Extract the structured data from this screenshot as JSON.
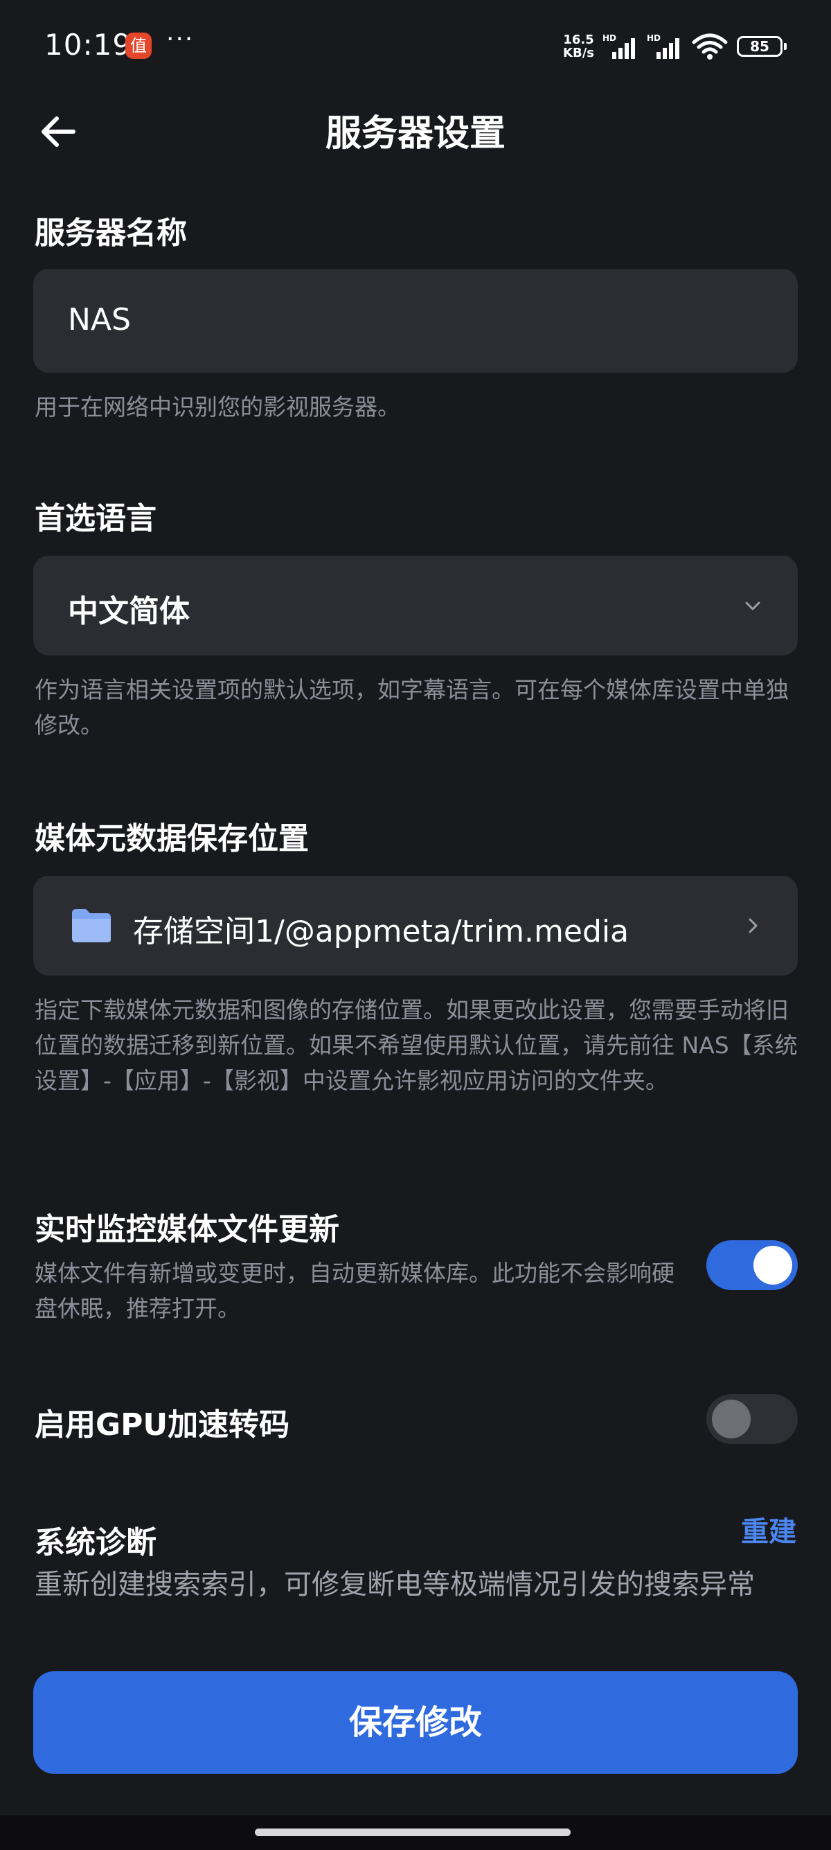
{
  "status_bar": {
    "time": "10:19",
    "app_badge": "值",
    "more": "···",
    "net_speed_value": "16.5",
    "net_speed_unit": "KB/s",
    "hd_1": "HD",
    "hd_2": "HD",
    "battery": "85"
  },
  "header": {
    "title": "服务器设置"
  },
  "server_name": {
    "label": "服务器名称",
    "value": "NAS",
    "help": "用于在网络中识别您的影视服务器。"
  },
  "language": {
    "label": "首选语言",
    "value": "中文简体",
    "help": "作为语言相关设置项的默认选项，如字幕语言。可在每个媒体库设置中单独修改。"
  },
  "metadata_location": {
    "label": "媒体元数据保存位置",
    "path": "存储空间1/@appmeta/trim.media",
    "help": "指定下载媒体元数据和图像的存储位置。如果更改此设置，您需要手动将旧位置的数据迁移到新位置。如果不希望使用默认位置，请先前往 NAS【系统设置】-【应用】-【影视】中设置允许影视应用访问的文件夹。"
  },
  "realtime_monitor": {
    "label": "实时监控媒体文件更新",
    "help": "媒体文件有新增或变更时，自动更新媒体库。此功能不会影响硬盘休眠，推荐打开。",
    "enabled": true
  },
  "gpu_transcode": {
    "label": "启用GPU加速转码",
    "enabled": false
  },
  "diagnostics": {
    "label": "系统诊断",
    "action": "重建",
    "help": "重新创建搜索索引，可修复断电等极端情况引发的搜索异常"
  },
  "save_button": "保存修改",
  "colors": {
    "background": "#18191d",
    "field": "#2b2d33",
    "accent": "#2f6bde",
    "link": "#4a86ee",
    "help_text": "#8a8f99"
  }
}
